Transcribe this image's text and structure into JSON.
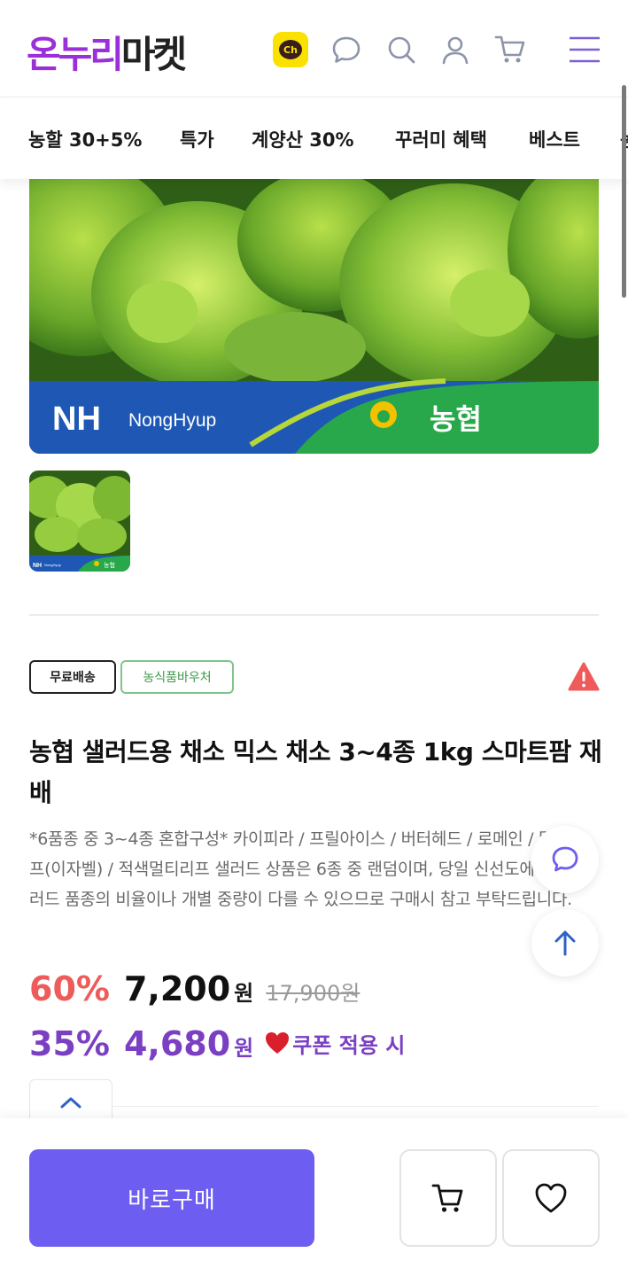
{
  "header": {
    "logo": {
      "part1": "온누리",
      "part2": "마켓"
    },
    "icons": [
      "kakao-channel-icon",
      "chat-bubble-icon",
      "search-icon",
      "user-icon",
      "cart-icon",
      "menu-icon"
    ],
    "channel_badge": "Ch"
  },
  "categories": [
    "농할 30+5%",
    "특가",
    "계양산 30%",
    "꾸러미 혜택",
    "베스트",
    "농"
  ],
  "product": {
    "banner": {
      "brand_en": "NH",
      "brand_en_sub": "NongHyup",
      "brand_ko": "농협"
    },
    "thumb": {
      "brand_en": "NH",
      "brand_en_sub": "NongHyup",
      "brand_ko": "농협"
    },
    "badges": {
      "free_shipping": "무료배송",
      "voucher": "농식품바우처"
    },
    "title": "농협 샐러드용 채소 믹스 채소 3~4종 1kg 스마트팜 재배",
    "description": "*6품종 중 3~4종 혼합구성* 카이피라 / 프릴아이스 / 버터헤드 / 로메인 / 멀티리프(이자벨) / 적색멀티리프 샐러드 상품은 6종 중 랜덤이며, 당일 신선도에 따라 샐러드 품종의 비율이나 개별 중량이 다를 수 있으므로 구매시 참고 부탁드립니다.",
    "price": {
      "discount_pct": "60%",
      "price": "7,200",
      "won": "원",
      "original": "17,900원"
    },
    "coupon": {
      "discount_pct": "35%",
      "price": "4,680",
      "won": "원",
      "label": "쿠폰 적용 시"
    }
  },
  "bottom": {
    "buy_label": "바로구매"
  },
  "colors": {
    "accent": "#6d5ef1",
    "logo_purple": "#9b30d9",
    "discount_red": "#ee5b5b",
    "coupon_purple": "#7b3fc4",
    "nh_blue": "#1e58b4",
    "nh_green": "#28a84a",
    "voucher_green": "#3a9a4a"
  }
}
